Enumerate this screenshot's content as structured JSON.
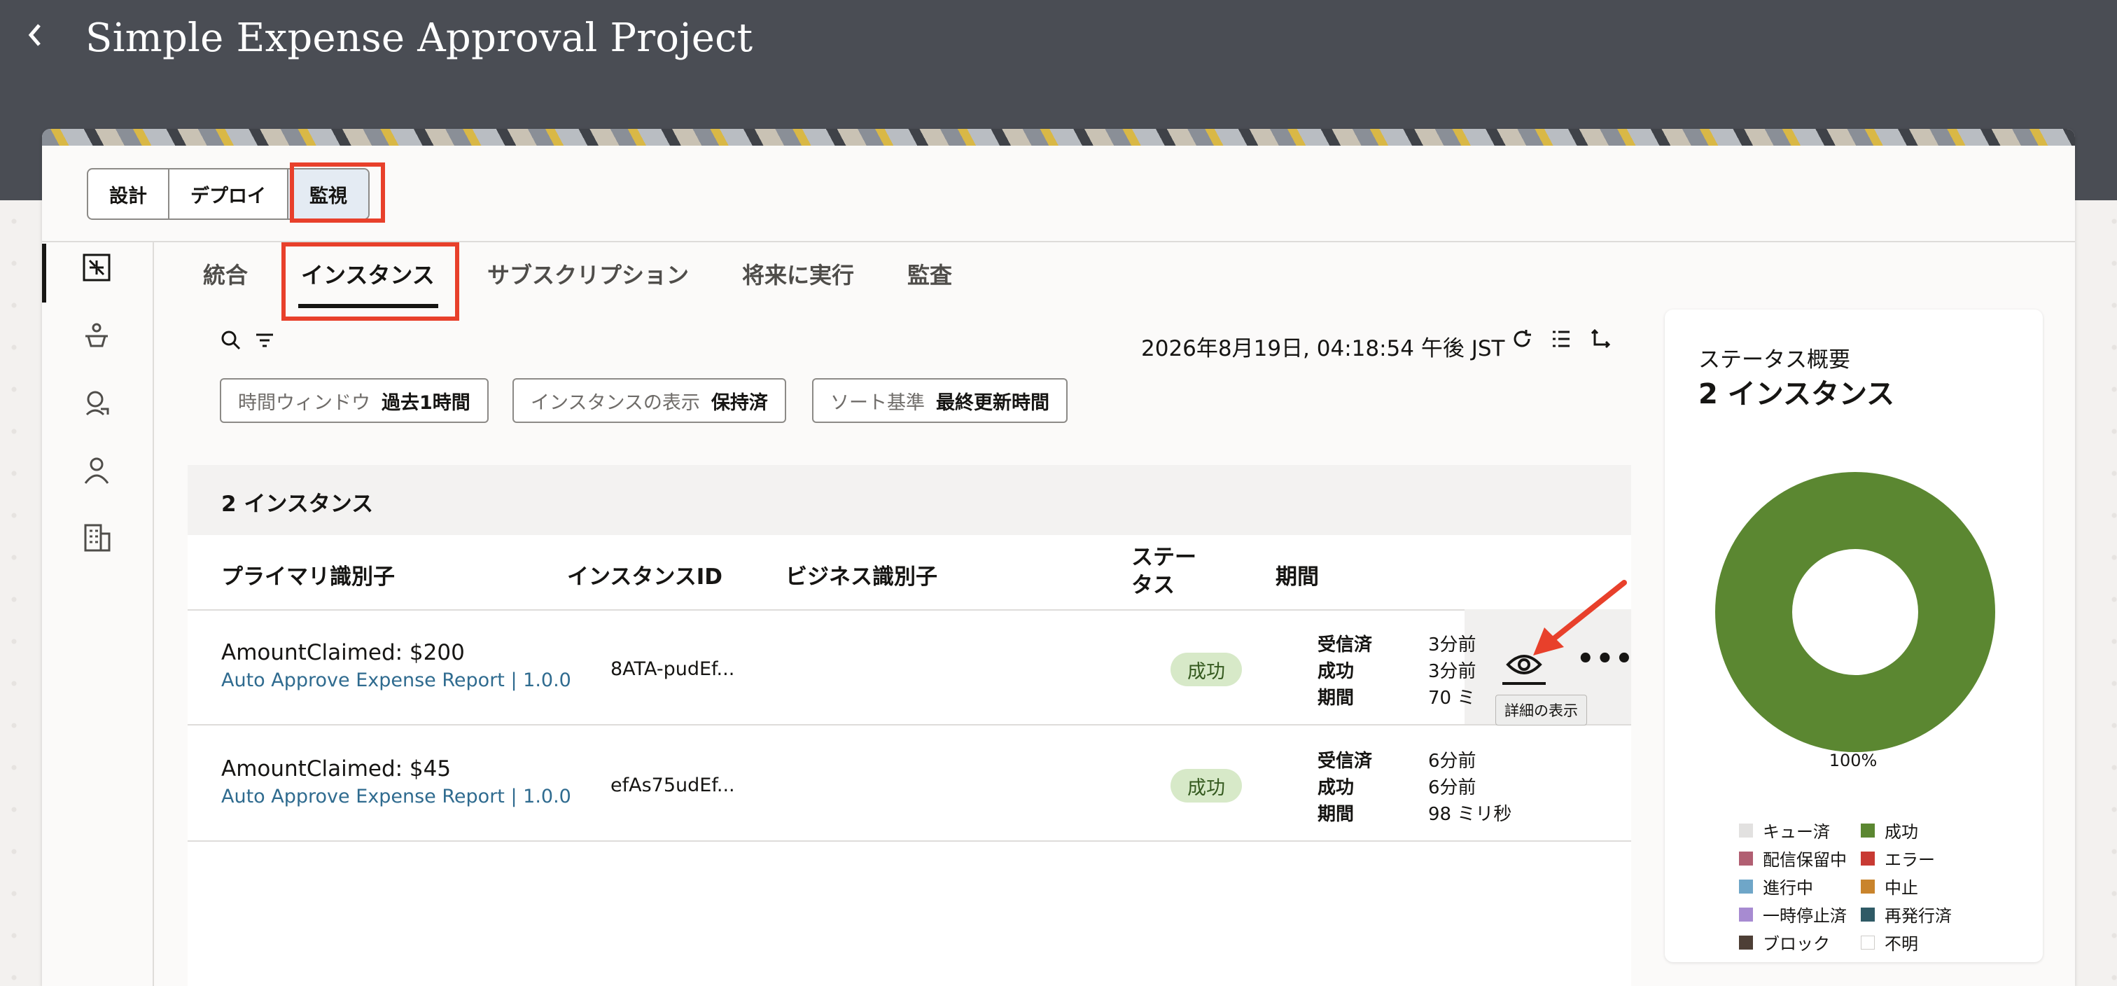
{
  "header": {
    "back_icon": "chevron-left-icon",
    "title": "Simple Expense Approval Project"
  },
  "mode_tabs": [
    {
      "label": "設計"
    },
    {
      "label": "デプロイ"
    },
    {
      "label": "監視",
      "selected": true
    }
  ],
  "rail_icons": [
    "integrations-icon",
    "agent-icon",
    "robot-icon",
    "user-icon",
    "building-icon"
  ],
  "sub_tabs": [
    {
      "label": "統合"
    },
    {
      "label": "インスタンス",
      "active": true
    },
    {
      "label": "サブスクリプション"
    },
    {
      "label": "将来に実行"
    },
    {
      "label": "監査"
    }
  ],
  "toolbar": {
    "timestamp": "2026年8月19日, 04:18:54 午後 JST",
    "icons": [
      "search-icon",
      "filter-icon",
      "refresh-icon",
      "list-view-icon",
      "trace-icon"
    ]
  },
  "chips": [
    {
      "key": "時間ウィンドウ",
      "value": "過去1時間"
    },
    {
      "key": "インスタンスの表示",
      "value": "保持済"
    },
    {
      "key": "ソート基準",
      "value": "最終更新時間"
    }
  ],
  "table": {
    "count_label": "2 インスタンス",
    "columns": {
      "primary": "プライマリ識別子",
      "instance_id": "インスタンスID",
      "business": "ビジネス識別子",
      "status": "ステータス",
      "status_line1": "ステー",
      "status_line2": "タス",
      "duration": "期間"
    },
    "rows": [
      {
        "primary": "AmountClaimed: $200",
        "integration": "Auto Approve Expense Report | 1.0.0",
        "instance_id": "8ATA-pudEf...",
        "status": "成功",
        "received_label": "受信済",
        "received": "3分前",
        "success_label": "成功",
        "success": "3分前",
        "duration_label": "期間",
        "duration": "70 ミ"
      },
      {
        "primary": "AmountClaimed: $45",
        "integration": "Auto Approve Expense Report | 1.0.0",
        "instance_id": "efAs75udEf...",
        "status": "成功",
        "received_label": "受信済",
        "received": "6分前",
        "success_label": "成功",
        "success": "6分前",
        "duration_label": "期間",
        "duration": "98 ミリ秒"
      }
    ],
    "row_actions": {
      "view_icon": "eye-icon",
      "more_icon": "more-icon",
      "more_label": "•••",
      "tooltip": "詳細の表示"
    }
  },
  "status_summary": {
    "title": "ステータス概要",
    "count": "2 インスタンス",
    "chart_data": {
      "type": "pie",
      "categories": [
        "成功"
      ],
      "values": [
        100
      ],
      "labels": [
        "100%"
      ],
      "colors": [
        "#5b8731"
      ]
    },
    "legend": [
      {
        "label": "キュー済",
        "color": "#e2e1e0"
      },
      {
        "label": "成功",
        "color": "#5b8731"
      },
      {
        "label": "配信保留中",
        "color": "#b15f72"
      },
      {
        "label": "エラー",
        "color": "#c83a33"
      },
      {
        "label": "進行中",
        "color": "#6fa6c8"
      },
      {
        "label": "中止",
        "color": "#c9842c"
      },
      {
        "label": "一時停止済",
        "color": "#a78bd1"
      },
      {
        "label": "再発行済",
        "color": "#2f5a66"
      },
      {
        "label": "ブロック",
        "color": "#4e3f36"
      },
      {
        "label": "不明",
        "color": "#ffffff"
      }
    ]
  },
  "colors": {
    "header_bg": "#4a4d54",
    "highlight_red": "#e8402b",
    "success_badge_bg": "#d7e9c8",
    "link_blue": "#2f6b8f"
  }
}
